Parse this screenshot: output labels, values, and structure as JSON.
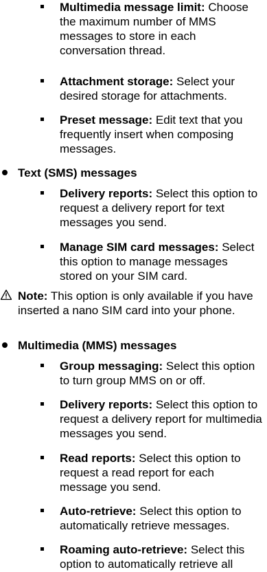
{
  "items": [
    {
      "kind": "square",
      "bold": "Multimedia message limit:",
      "text": " Choose the maximum number of MMS messages to store in each conversation thread."
    },
    {
      "kind": "square",
      "bold": "Attachment storage:",
      "text": " Select your desired storage for attachments."
    },
    {
      "kind": "square",
      "bold": "Preset message:",
      "text": " Edit text that you frequently insert when composing messages."
    },
    {
      "kind": "dot",
      "bold": "Text (SMS) messages"
    },
    {
      "kind": "square",
      "bold": "Delivery reports:",
      "text": " Select this option to request a delivery report for text messages you send."
    },
    {
      "kind": "square",
      "bold": "Manage SIM card messages:",
      "text": " Select this option to manage messages stored on your SIM card."
    },
    {
      "kind": "note",
      "icon": "warning-triangle-icon",
      "bold": "Note:",
      "text": " This option is only available if you have inserted a nano SIM card into your phone."
    },
    {
      "kind": "dot",
      "bold": "Multimedia (MMS) messages"
    },
    {
      "kind": "square",
      "bold": "Group messaging:",
      "text": " Select this option to turn group MMS on or off."
    },
    {
      "kind": "square",
      "bold": "Delivery reports:",
      "text": " Select this option to request a delivery report for multimedia messages you send."
    },
    {
      "kind": "square",
      "bold": "Read reports:",
      "text": " Select this option to request a read report for each message you send."
    },
    {
      "kind": "square",
      "bold": "Auto-retrieve:",
      "text": " Select this option to automatically retrieve messages."
    },
    {
      "kind": "square",
      "bold": "Roaming auto-retrieve:",
      "text": " Select this option to automatically retrieve all"
    }
  ]
}
